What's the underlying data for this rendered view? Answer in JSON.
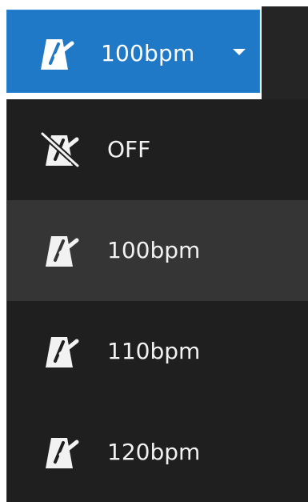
{
  "tempo_button": {
    "label": "100bpm",
    "icon": "metronome-icon",
    "caret_icon": "caret-down-icon",
    "background": "#2079c7"
  },
  "menu": {
    "items": [
      {
        "label": "OFF",
        "icon": "metronome-off-icon",
        "selected": false
      },
      {
        "label": "100bpm",
        "icon": "metronome-icon",
        "selected": true
      },
      {
        "label": "110bpm",
        "icon": "metronome-icon",
        "selected": false
      },
      {
        "label": "120bpm",
        "icon": "metronome-icon",
        "selected": false
      }
    ],
    "background": "#1f1f1f",
    "selected_background": "#353535"
  }
}
